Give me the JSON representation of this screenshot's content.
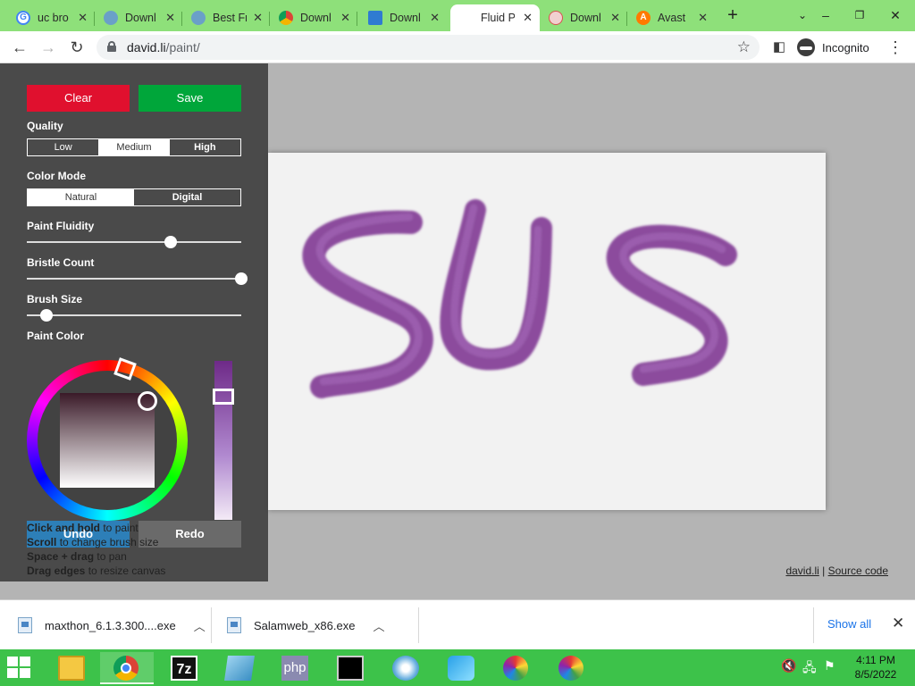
{
  "browser": {
    "tabs": [
      {
        "title": "uc bro",
        "icon": "google-icon",
        "color": "#4285f4"
      },
      {
        "title": "Downl",
        "icon": "globe-icon",
        "color": "#6aa0c8"
      },
      {
        "title": "Best Fr",
        "icon": "globe-icon",
        "color": "#6aa0c8"
      },
      {
        "title": "Downl",
        "icon": "chrome-icon",
        "color": "#db4437"
      },
      {
        "title": "Downl",
        "icon": "window-icon",
        "color": "#2f7bd1"
      },
      {
        "title": "Fluid P",
        "icon": "blank-icon",
        "color": "#ffffff",
        "active": true
      },
      {
        "title": "Downl",
        "icon": "shield-icon",
        "color": "#d9534f"
      },
      {
        "title": "Avast",
        "icon": "avast-icon",
        "color": "#ff7a00"
      }
    ],
    "url_host": "david.li",
    "url_path": "/paint/",
    "incognito_label": "Incognito"
  },
  "panel": {
    "clear_label": "Clear",
    "save_label": "Save",
    "clear_color": "#e0102e",
    "save_color": "#00a63a",
    "quality_label": "Quality",
    "quality_options": [
      "Low",
      "Medium",
      "High"
    ],
    "quality_selected": "Medium",
    "color_mode_label": "Color Mode",
    "color_mode_options": [
      "Natural",
      "Digital"
    ],
    "color_mode_selected": "Natural",
    "paint_fluidity_label": "Paint Fluidity",
    "paint_fluidity_value": 0.67,
    "bristle_count_label": "Bristle Count",
    "bristle_count_value": 1.0,
    "brush_size_label": "Brush Size",
    "brush_size_value": 0.09,
    "paint_color_label": "Paint Color",
    "undo_label": "Undo",
    "redo_label": "Redo",
    "hints": [
      {
        "bold": "Click and hold",
        "rest": " to paint"
      },
      {
        "bold": "Scroll",
        "rest": " to change brush size"
      },
      {
        "bold": "Space + drag",
        "rest": " to pan"
      },
      {
        "bold": "Drag edges",
        "rest": " to resize canvas"
      }
    ]
  },
  "canvas": {
    "text_painted": "SUS",
    "paint_color": "#7a2e8e"
  },
  "footer": {
    "site_link": "david.li",
    "divider": "|",
    "source_link": "Source code"
  },
  "downloads": {
    "items": [
      "maxthon_6.1.3.300....exe",
      "Salamweb_x86.exe"
    ],
    "show_all": "Show all"
  },
  "taskbar": {
    "apps": [
      "file-explorer-icon",
      "chrome-icon",
      "7zip-icon",
      "notepad-icon",
      "php-icon",
      "cmd-icon",
      "media-icon",
      "waterfox-icon",
      "pinwheel-icon",
      "pinwheel-icon"
    ],
    "time": "4:11 PM",
    "date": "8/5/2022"
  }
}
